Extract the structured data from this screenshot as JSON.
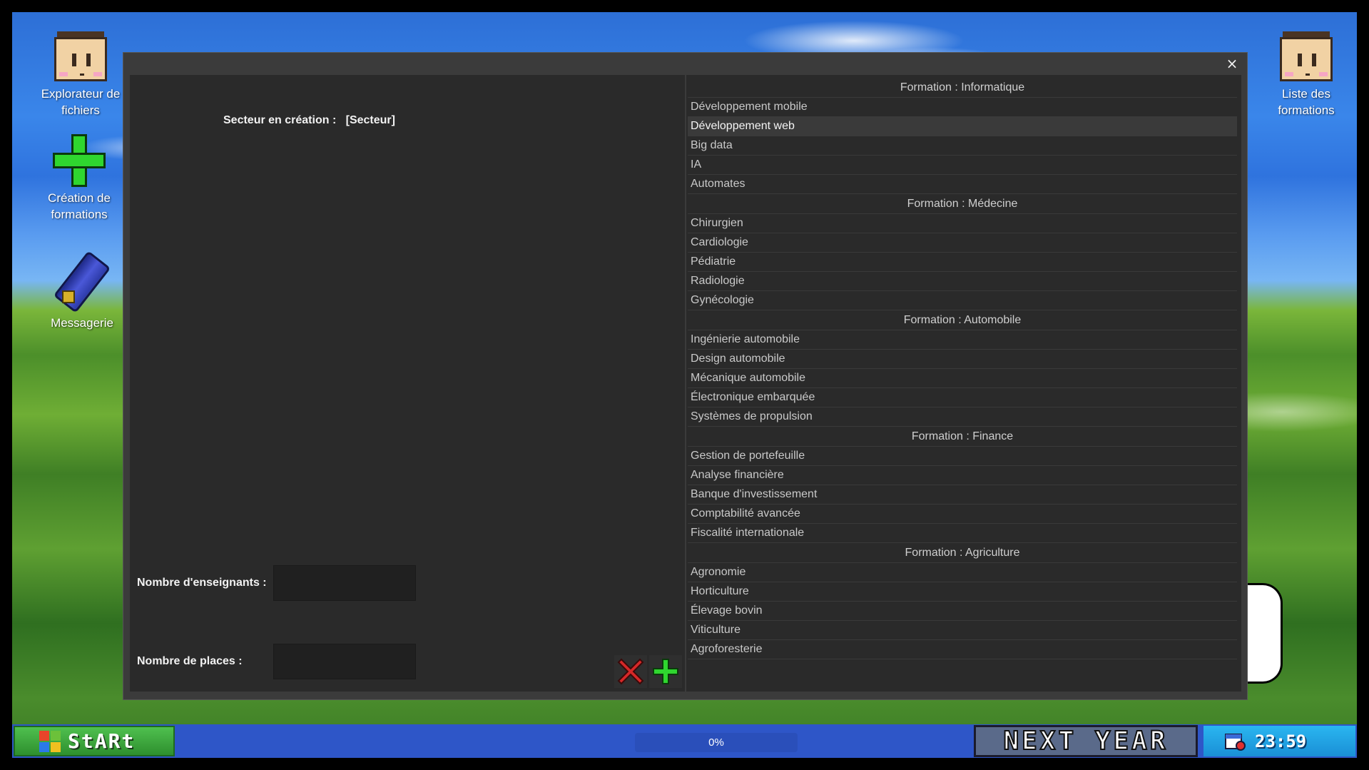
{
  "desktop_icons": {
    "file_explorer": "Explorateur de fichiers",
    "course_creation": "Création de formations",
    "messaging": "Messagerie",
    "course_list": "Liste des formations"
  },
  "window": {
    "close_symbol": "×",
    "form": {
      "sector_label": "Secteur en création :",
      "sector_value": "[Secteur]",
      "teachers_label": "Nombre d'enseignants :",
      "teachers_value": "",
      "places_label": "Nombre de places :",
      "places_value": ""
    },
    "groups": [
      {
        "header": "Formation : Informatique",
        "items": [
          "Développement mobile",
          "Développement web",
          "Big data",
          "IA",
          "Automates"
        ]
      },
      {
        "header": "Formation : Médecine",
        "items": [
          "Chirurgien",
          "Cardiologie",
          "Pédiatrie",
          "Radiologie",
          "Gynécologie"
        ]
      },
      {
        "header": "Formation : Automobile",
        "items": [
          "Ingénierie automobile",
          "Design automobile",
          "Mécanique automobile",
          "Électronique embarquée",
          "Systèmes de propulsion"
        ]
      },
      {
        "header": "Formation : Finance",
        "items": [
          "Gestion de portefeuille",
          "Analyse financière",
          "Banque d'investissement",
          "Comptabilité avancée",
          "Fiscalité internationale"
        ]
      },
      {
        "header": "Formation : Agriculture",
        "items": [
          "Agronomie",
          "Horticulture",
          "Élevage bovin",
          "Viticulture",
          "Agroforesterie"
        ]
      }
    ],
    "selected_item": "Développement web"
  },
  "taskbar": {
    "start_label": "StARt",
    "progress_label": "0%",
    "progress_value": 0,
    "next_year_label": "NEXT YEAR",
    "clock": "23:59"
  },
  "colors": {
    "cancel": "#d62828",
    "confirm": "#2fd62f",
    "taskbar": "#2e56c8",
    "window": "#3b3b3b"
  }
}
